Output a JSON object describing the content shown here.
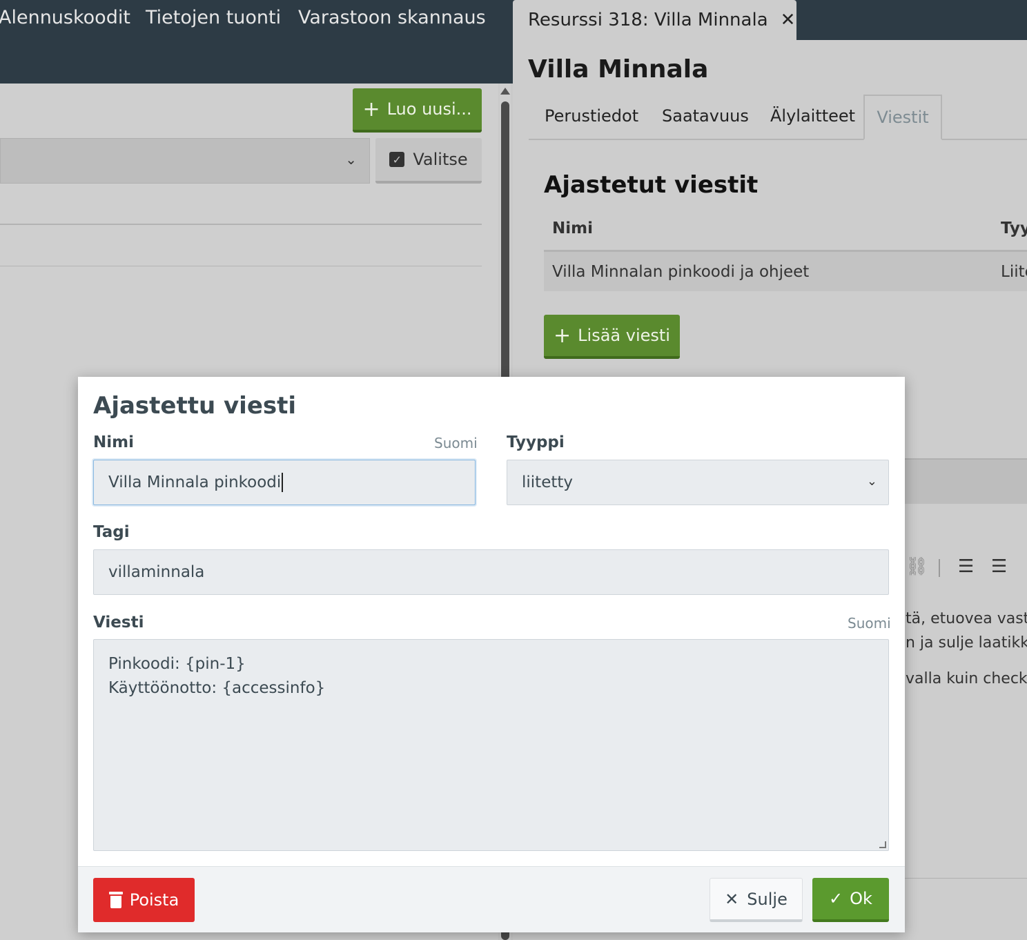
{
  "nav": {
    "items": [
      "Alennuskoodit",
      "Tietojen tuonti",
      "Varastoon skannaus"
    ]
  },
  "left_panel": {
    "create_button_label": "Luo uusi...",
    "select_button_label": "Valitse"
  },
  "resource_panel": {
    "tab_title": "Resurssi 318: Villa Minnala",
    "title": "Villa Minnala",
    "tabs": [
      "Perustiedot",
      "Saatavuus",
      "Älylaitteet",
      "Viestit"
    ],
    "active_tab": "Viestit",
    "section_title": "Ajastetut viestit",
    "table": {
      "headers": [
        "Nimi",
        "Tyy"
      ],
      "rows": [
        [
          "Villa Minnalan pinkoodi ja ohjeet",
          "Liite"
        ]
      ]
    },
    "add_button_label": "Lisää viesti",
    "background_text": [
      "tä, etuovea vasta",
      "n ja sulje laatikko",
      "valla kuin checki"
    ]
  },
  "modal": {
    "title": "Ajastettu viesti",
    "name_label": "Nimi",
    "name_lang": "Suomi",
    "name_value": "Villa Minnala pinkoodi",
    "type_label": "Tyyppi",
    "type_value": "liitetty",
    "tag_label": "Tagi",
    "tag_value": "villaminnala",
    "message_label": "Viesti",
    "message_lang": "Suomi",
    "message_lines": [
      "Pinkoodi: {pin-1}",
      "Käyttöönotto: {accessinfo}"
    ],
    "delete_label": "Poista",
    "close_label": "Sulje",
    "ok_label": "Ok"
  },
  "colors": {
    "nav_bg": "#2d3b45",
    "green": "#5b9a2e",
    "red": "#e02b2b"
  }
}
